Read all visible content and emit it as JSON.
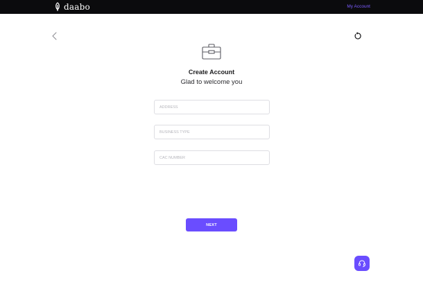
{
  "brand": {
    "name": "daabo"
  },
  "header": {
    "account_link": "My Account"
  },
  "form": {
    "title": "Create Account",
    "subtitle": "Glad to welcome you",
    "fields": [
      {
        "placeholder": "ADDRESS",
        "value": ""
      },
      {
        "placeholder": "BUSINESS TYPE",
        "value": ""
      },
      {
        "placeholder": "CAC NUMBER",
        "value": ""
      }
    ],
    "submit_label": "NEXT"
  },
  "icons": {
    "back": "chevron-left-icon",
    "refresh": "refresh-icon",
    "hero": "briefcase-icon",
    "help": "headset-icon",
    "brand": "leaf-logo-icon"
  },
  "colors": {
    "topbar": "#0b0b0d",
    "accent": "#6a4dff",
    "link": "#7c5cff"
  }
}
